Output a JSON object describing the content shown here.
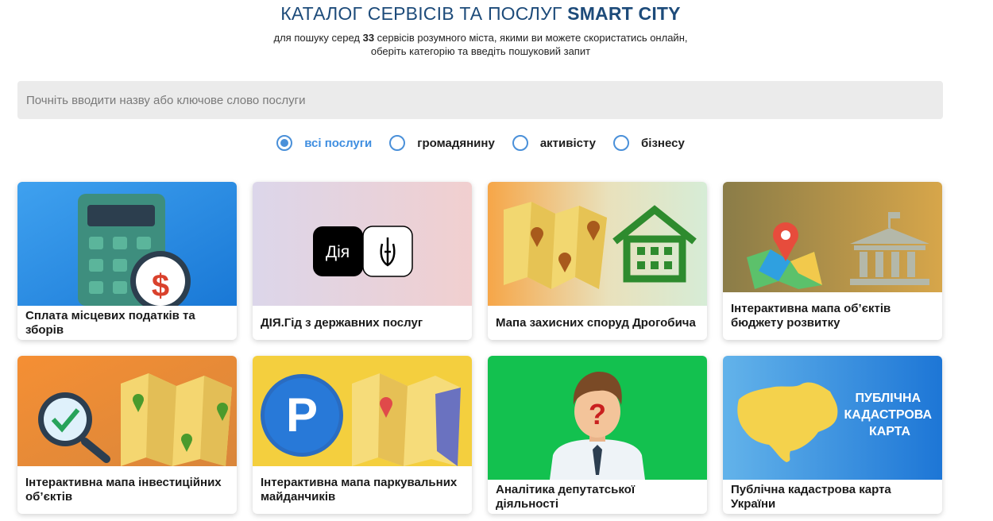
{
  "header": {
    "title_plain": "КАТАЛОГ СЕРВІСІВ ТА ПОСЛУГ ",
    "title_bold": "SMART CITY",
    "subtitle_pre": "для пошуку серед ",
    "subtitle_count": "33",
    "subtitle_post": " сервісів розумного міста, якими ви можете скористатись онлайн,",
    "subtitle_line2": "оберіть категорію та введіть пошуковий запит"
  },
  "search": {
    "placeholder": "Почніть вводити назву або ключове слово послуги",
    "value": ""
  },
  "filters": [
    {
      "label": "всі послуги",
      "selected": true
    },
    {
      "label": "громадянину",
      "selected": false
    },
    {
      "label": "активісту",
      "selected": false
    },
    {
      "label": "бізнесу",
      "selected": false
    }
  ],
  "cards": [
    {
      "title": "Сплата місцевих податків та зборів",
      "icon": "calculator-dollar-icon"
    },
    {
      "title": "ДІЯ.Гід з державних послуг",
      "icon": "diia-logo",
      "logo_text": "Дія"
    },
    {
      "title": "Мапа захисних споруд Дрогобича",
      "icon": "shelter-map-icon"
    },
    {
      "title": "Інтерактивна мапа об’єктів бюджету розвитку",
      "icon": "budget-map-icon"
    },
    {
      "title": "Інтерактивна мапа інвестиційних об’єктів",
      "icon": "investment-map-icon"
    },
    {
      "title": "Інтерактивна мапа паркувальних майданчиків",
      "icon": "parking-map-icon",
      "logo_text": "P"
    },
    {
      "title": "Аналітика депутатської діяльності",
      "icon": "deputy-analytics-icon",
      "logo_text": "?"
    },
    {
      "title": "Публічна кадастрова карта України",
      "icon": "cadastral-map-icon",
      "logo_lines": [
        "ПУБЛІЧНА",
        "КАДАСТРОВА",
        "КАРТА"
      ]
    }
  ],
  "colors": {
    "accent": "#4a90d9",
    "title": "#1d4b7a",
    "search_bg": "#ebebeb"
  }
}
